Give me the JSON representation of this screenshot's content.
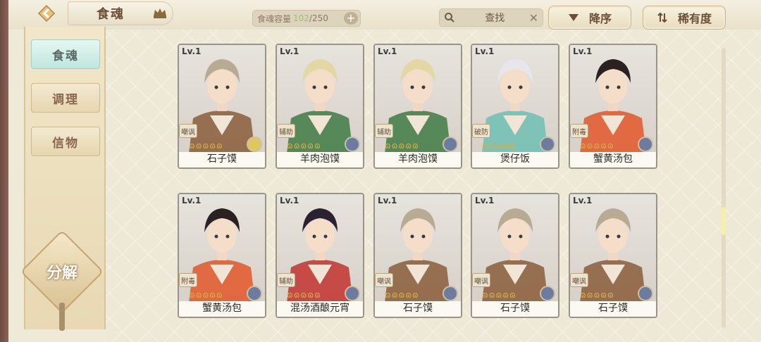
{
  "header": {
    "title": "食魂",
    "capacity_label": "食魂容量",
    "capacity_current": "102",
    "capacity_max": "/250",
    "search_placeholder": "查找",
    "sort_desc": "降序",
    "sort_rarity": "稀有度"
  },
  "sidebar": {
    "tabs": [
      {
        "label": "食魂",
        "active": true
      },
      {
        "label": "调理",
        "active": false
      },
      {
        "label": "信物",
        "active": false
      }
    ],
    "decompose": "分解"
  },
  "cards": [
    {
      "lv": "Lv.1",
      "role": "嘲讽",
      "name": "石子馍",
      "element": "gold",
      "hair": "#b8ab94",
      "outfit": "#8a5c3a"
    },
    {
      "lv": "Lv.1",
      "role": "辅助",
      "name": "羊肉泡馍",
      "element": "blue",
      "hair": "#e3d7a4",
      "outfit": "#3e7a44"
    },
    {
      "lv": "Lv.1",
      "role": "辅助",
      "name": "羊肉泡馍",
      "element": "blue",
      "hair": "#e3d7a4",
      "outfit": "#3e7a44"
    },
    {
      "lv": "Lv.1",
      "role": "破防",
      "name": "煲仔饭",
      "element": "blue",
      "hair": "#e8e6ec",
      "outfit": "#6fbfb4"
    },
    {
      "lv": "Lv.1",
      "role": "附毒",
      "name": "蟹黄汤包",
      "element": "blue",
      "hair": "#2a2220",
      "outfit": "#e2572a"
    },
    {
      "lv": "Lv.1",
      "role": "附毒",
      "name": "蟹黄汤包",
      "element": "blue",
      "hair": "#2a2220",
      "outfit": "#e2572a"
    },
    {
      "lv": "Lv.1",
      "role": "辅助",
      "name": "混汤酒酿元宵",
      "element": "blue",
      "hair": "#2a2230",
      "outfit": "#c2312e"
    },
    {
      "lv": "Lv.1",
      "role": "嘲讽",
      "name": "石子馍",
      "element": "blue",
      "hair": "#b8ab94",
      "outfit": "#8a5c3a"
    },
    {
      "lv": "Lv.1",
      "role": "嘲讽",
      "name": "石子馍",
      "element": "blue",
      "hair": "#b8ab94",
      "outfit": "#8a5c3a"
    },
    {
      "lv": "Lv.1",
      "role": "嘲讽",
      "name": "石子馍",
      "element": "blue",
      "hair": "#b8ab94",
      "outfit": "#8a5c3a"
    }
  ],
  "stars": "ɷɷɷɷɷ"
}
